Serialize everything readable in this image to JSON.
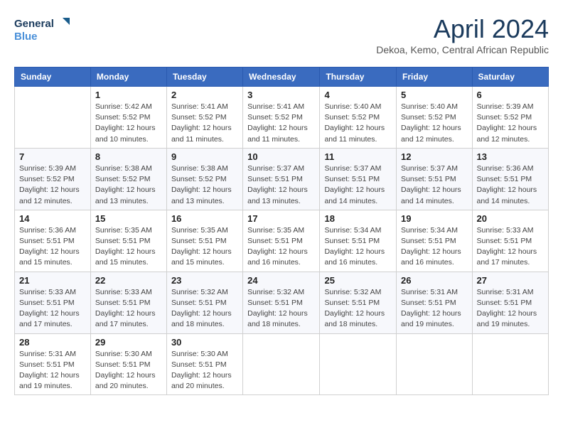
{
  "header": {
    "logo_line1": "General",
    "logo_line2": "Blue",
    "month": "April 2024",
    "location": "Dekoa, Kemo, Central African Republic"
  },
  "weekdays": [
    "Sunday",
    "Monday",
    "Tuesday",
    "Wednesday",
    "Thursday",
    "Friday",
    "Saturday"
  ],
  "weeks": [
    [
      {
        "day": "",
        "info": ""
      },
      {
        "day": "1",
        "info": "Sunrise: 5:42 AM\nSunset: 5:52 PM\nDaylight: 12 hours\nand 10 minutes."
      },
      {
        "day": "2",
        "info": "Sunrise: 5:41 AM\nSunset: 5:52 PM\nDaylight: 12 hours\nand 11 minutes."
      },
      {
        "day": "3",
        "info": "Sunrise: 5:41 AM\nSunset: 5:52 PM\nDaylight: 12 hours\nand 11 minutes."
      },
      {
        "day": "4",
        "info": "Sunrise: 5:40 AM\nSunset: 5:52 PM\nDaylight: 12 hours\nand 11 minutes."
      },
      {
        "day": "5",
        "info": "Sunrise: 5:40 AM\nSunset: 5:52 PM\nDaylight: 12 hours\nand 12 minutes."
      },
      {
        "day": "6",
        "info": "Sunrise: 5:39 AM\nSunset: 5:52 PM\nDaylight: 12 hours\nand 12 minutes."
      }
    ],
    [
      {
        "day": "7",
        "info": "Sunrise: 5:39 AM\nSunset: 5:52 PM\nDaylight: 12 hours\nand 12 minutes."
      },
      {
        "day": "8",
        "info": "Sunrise: 5:38 AM\nSunset: 5:52 PM\nDaylight: 12 hours\nand 13 minutes."
      },
      {
        "day": "9",
        "info": "Sunrise: 5:38 AM\nSunset: 5:52 PM\nDaylight: 12 hours\nand 13 minutes."
      },
      {
        "day": "10",
        "info": "Sunrise: 5:37 AM\nSunset: 5:51 PM\nDaylight: 12 hours\nand 13 minutes."
      },
      {
        "day": "11",
        "info": "Sunrise: 5:37 AM\nSunset: 5:51 PM\nDaylight: 12 hours\nand 14 minutes."
      },
      {
        "day": "12",
        "info": "Sunrise: 5:37 AM\nSunset: 5:51 PM\nDaylight: 12 hours\nand 14 minutes."
      },
      {
        "day": "13",
        "info": "Sunrise: 5:36 AM\nSunset: 5:51 PM\nDaylight: 12 hours\nand 14 minutes."
      }
    ],
    [
      {
        "day": "14",
        "info": "Sunrise: 5:36 AM\nSunset: 5:51 PM\nDaylight: 12 hours\nand 15 minutes."
      },
      {
        "day": "15",
        "info": "Sunrise: 5:35 AM\nSunset: 5:51 PM\nDaylight: 12 hours\nand 15 minutes."
      },
      {
        "day": "16",
        "info": "Sunrise: 5:35 AM\nSunset: 5:51 PM\nDaylight: 12 hours\nand 15 minutes."
      },
      {
        "day": "17",
        "info": "Sunrise: 5:35 AM\nSunset: 5:51 PM\nDaylight: 12 hours\nand 16 minutes."
      },
      {
        "day": "18",
        "info": "Sunrise: 5:34 AM\nSunset: 5:51 PM\nDaylight: 12 hours\nand 16 minutes."
      },
      {
        "day": "19",
        "info": "Sunrise: 5:34 AM\nSunset: 5:51 PM\nDaylight: 12 hours\nand 16 minutes."
      },
      {
        "day": "20",
        "info": "Sunrise: 5:33 AM\nSunset: 5:51 PM\nDaylight: 12 hours\nand 17 minutes."
      }
    ],
    [
      {
        "day": "21",
        "info": "Sunrise: 5:33 AM\nSunset: 5:51 PM\nDaylight: 12 hours\nand 17 minutes."
      },
      {
        "day": "22",
        "info": "Sunrise: 5:33 AM\nSunset: 5:51 PM\nDaylight: 12 hours\nand 17 minutes."
      },
      {
        "day": "23",
        "info": "Sunrise: 5:32 AM\nSunset: 5:51 PM\nDaylight: 12 hours\nand 18 minutes."
      },
      {
        "day": "24",
        "info": "Sunrise: 5:32 AM\nSunset: 5:51 PM\nDaylight: 12 hours\nand 18 minutes."
      },
      {
        "day": "25",
        "info": "Sunrise: 5:32 AM\nSunset: 5:51 PM\nDaylight: 12 hours\nand 18 minutes."
      },
      {
        "day": "26",
        "info": "Sunrise: 5:31 AM\nSunset: 5:51 PM\nDaylight: 12 hours\nand 19 minutes."
      },
      {
        "day": "27",
        "info": "Sunrise: 5:31 AM\nSunset: 5:51 PM\nDaylight: 12 hours\nand 19 minutes."
      }
    ],
    [
      {
        "day": "28",
        "info": "Sunrise: 5:31 AM\nSunset: 5:51 PM\nDaylight: 12 hours\nand 19 minutes."
      },
      {
        "day": "29",
        "info": "Sunrise: 5:30 AM\nSunset: 5:51 PM\nDaylight: 12 hours\nand 20 minutes."
      },
      {
        "day": "30",
        "info": "Sunrise: 5:30 AM\nSunset: 5:51 PM\nDaylight: 12 hours\nand 20 minutes."
      },
      {
        "day": "",
        "info": ""
      },
      {
        "day": "",
        "info": ""
      },
      {
        "day": "",
        "info": ""
      },
      {
        "day": "",
        "info": ""
      }
    ]
  ]
}
